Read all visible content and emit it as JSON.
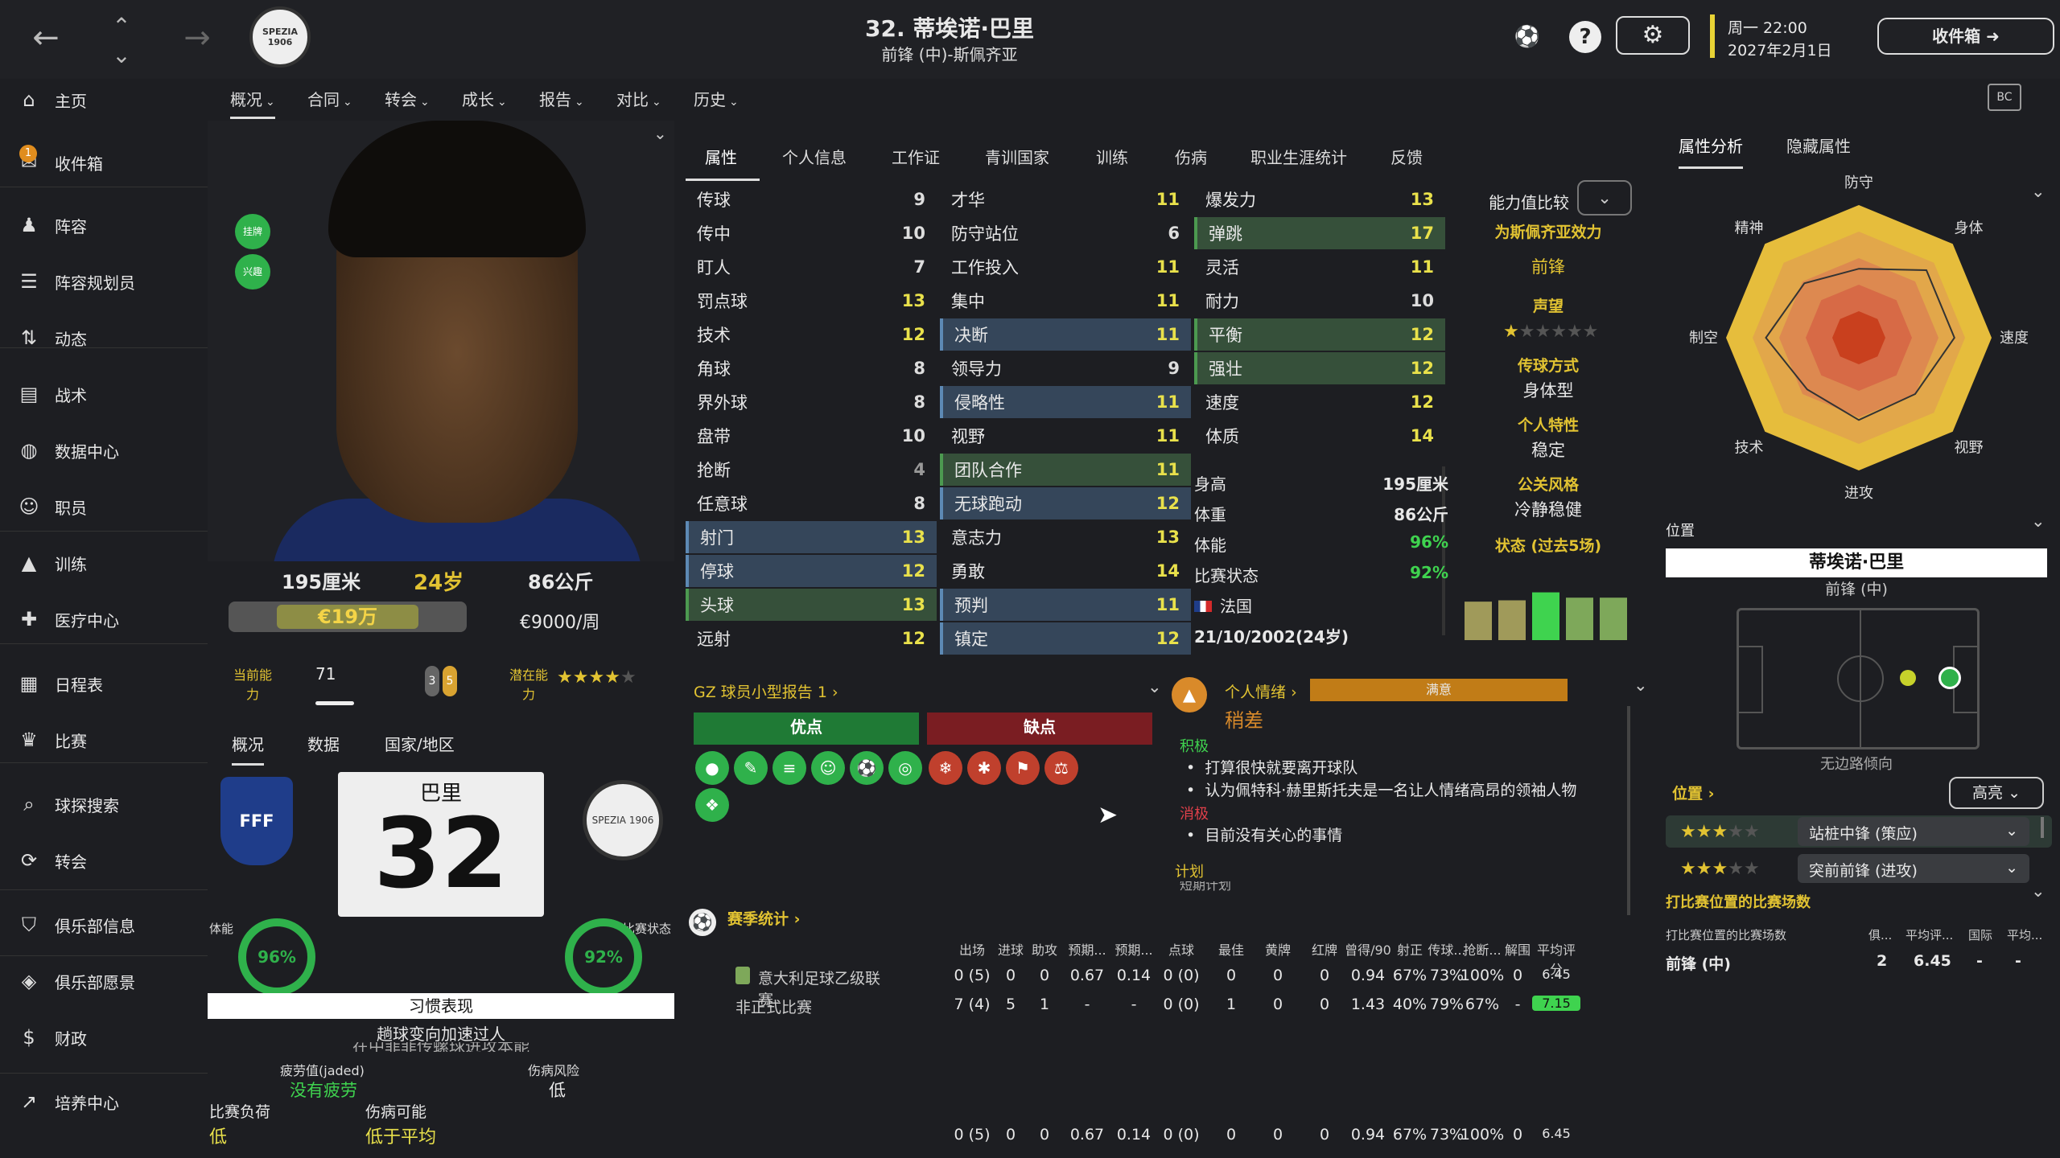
{
  "header": {
    "player_title": "32. 蒂埃诺·巴里",
    "player_subtitle": "前锋 (中)-斯佩齐亚",
    "date_day": "周一 22:00",
    "date_full": "2027年2月1日",
    "inbox_label": "收件箱",
    "club_crest_text": "SPEZIA 1906"
  },
  "sidebar": {
    "items": [
      {
        "label": "主页",
        "icon": "home-icon"
      },
      {
        "label": "收件箱",
        "icon": "inbox-icon",
        "badge": "1"
      },
      {
        "label": "阵容",
        "icon": "squad-icon"
      },
      {
        "label": "阵容规划员",
        "icon": "planner-icon"
      },
      {
        "label": "动态",
        "icon": "dynamics-icon"
      },
      {
        "label": "战术",
        "icon": "tactics-icon"
      },
      {
        "label": "数据中心",
        "icon": "data-hub-icon"
      },
      {
        "label": "职员",
        "icon": "staff-icon"
      },
      {
        "label": "训练",
        "icon": "training-icon"
      },
      {
        "label": "医疗中心",
        "icon": "medical-icon"
      },
      {
        "label": "日程表",
        "icon": "calendar-icon"
      },
      {
        "label": "比赛",
        "icon": "trophy-icon"
      },
      {
        "label": "球探搜索",
        "icon": "search-icon"
      },
      {
        "label": "转会",
        "icon": "transfer-icon"
      },
      {
        "label": "俱乐部信息",
        "icon": "club-info-icon"
      },
      {
        "label": "俱乐部愿景",
        "icon": "club-vision-icon"
      },
      {
        "label": "财政",
        "icon": "finance-icon"
      },
      {
        "label": "培养中心",
        "icon": "development-icon"
      }
    ]
  },
  "subnav": [
    "概况",
    "合同",
    "转会",
    "成长",
    "报告",
    "对比",
    "历史"
  ],
  "profile": {
    "height": "195厘米",
    "age": "24岁",
    "weight": "86公斤",
    "value": "€19万",
    "wage": "€9000/周",
    "current_ability_label": "当前能力",
    "current_ability_value": "71",
    "potential_label": "潜在能力",
    "potential_stars": 4,
    "potential_max": 5,
    "badges": [
      "挂牌",
      "兴趣"
    ],
    "role_min": "3",
    "role_max": "5"
  },
  "lower_tabs": [
    "概况",
    "数据",
    "国家/地区"
  ],
  "kit": {
    "name": "巴里",
    "number": "32"
  },
  "rings": {
    "fitness_label": "体能",
    "fitness": "96%",
    "form_label": "比赛状态",
    "form": "92%"
  },
  "habits": {
    "title": "习惯表现",
    "line1": "趟球变向加速过人",
    "line2": "在中菲菲传螺球进攻本能"
  },
  "condition": {
    "jaded_label": "疲劳值(jaded)",
    "jaded_value": "没有疲劳",
    "injury_label": "伤病风险",
    "injury_value": "低",
    "load_label": "比赛负荷",
    "load_value": "低",
    "injury_prob_label": "伤病可能",
    "injury_prob_value": "低于平均"
  },
  "attr_tabs": [
    "属性",
    "个人信息",
    "工作证",
    "青训国家",
    "训练",
    "伤病",
    "职业生涯统计",
    "反馈"
  ],
  "technical": [
    [
      "传球",
      "9"
    ],
    [
      "传中",
      "10"
    ],
    [
      "盯人",
      "7"
    ],
    [
      "罚点球",
      "13"
    ],
    [
      "技术",
      "12"
    ],
    [
      "角球",
      "8"
    ],
    [
      "界外球",
      "8"
    ],
    [
      "盘带",
      "10"
    ],
    [
      "抢断",
      "4"
    ],
    [
      "任意球",
      "8"
    ],
    [
      "射门",
      "13"
    ],
    [
      "停球",
      "12"
    ],
    [
      "头球",
      "13"
    ],
    [
      "远射",
      "12"
    ]
  ],
  "mental": [
    [
      "才华",
      "11"
    ],
    [
      "防守站位",
      "6"
    ],
    [
      "工作投入",
      "11"
    ],
    [
      "集中",
      "11"
    ],
    [
      "决断",
      "11"
    ],
    [
      "领导力",
      "9"
    ],
    [
      "侵略性",
      "11"
    ],
    [
      "视野",
      "11"
    ],
    [
      "团队合作",
      "11"
    ],
    [
      "无球跑动",
      "12"
    ],
    [
      "意志力",
      "13"
    ],
    [
      "勇敢",
      "14"
    ],
    [
      "预判",
      "11"
    ],
    [
      "镇定",
      "12"
    ]
  ],
  "physical": [
    [
      "爆发力",
      "13"
    ],
    [
      "弹跳",
      "17"
    ],
    [
      "灵活",
      "11"
    ],
    [
      "耐力",
      "10"
    ],
    [
      "平衡",
      "12"
    ],
    [
      "强壮",
      "12"
    ],
    [
      "速度",
      "12"
    ],
    [
      "体质",
      "14"
    ]
  ],
  "stats": [
    [
      "身高",
      "195厘米"
    ],
    [
      "体重",
      "86公斤"
    ],
    [
      "体能",
      "96%"
    ],
    [
      "比赛状态",
      "92%"
    ],
    [
      "国籍",
      "法国"
    ],
    [
      "生日",
      "21/10/2002(24岁)"
    ]
  ],
  "compare": {
    "label": "能力值比较",
    "team_label": "为斯佩齐亚效力",
    "team_value": "前锋",
    "rep_label": "声望",
    "rep_stars": 1,
    "rep_max": 6,
    "style_label": "传球方式",
    "style_value": "身体型",
    "personality_label": "个人特性",
    "personality_value": "稳定",
    "media_label": "公关风格",
    "media_value": "冷静稳健",
    "form_label": "状态 (过去5场)",
    "form_values": [
      5.8,
      6.0,
      7.2,
      6.4,
      6.4
    ]
  },
  "scout": {
    "title": "GZ 球员小型报告 1",
    "strengths_label": "优点",
    "weaknesses_label": "缺点"
  },
  "mood": {
    "title": "个人情绪",
    "status": "满意",
    "level": "稍差",
    "positive_label": "积极",
    "positive_items": [
      "打算很快就要离开球队",
      "认为佩特科·赫里斯托夫是一名让人情绪高昂的领袖人物"
    ],
    "negative_label": "消极",
    "negative_items": [
      "目前没有关心的事情"
    ],
    "plan_label": "计划",
    "plan_sub": "短期计划"
  },
  "season": {
    "title": "赛季统计",
    "headers": [
      "出场",
      "进球",
      "助攻",
      "预期...",
      "预期...",
      "点球",
      "最佳",
      "黄牌",
      "红牌",
      "曾得/90",
      "射正",
      "传球...",
      "抢断...",
      "解围",
      "平均评分"
    ],
    "rows": [
      {
        "name": "意大利足球乙级联赛",
        "cells": [
          "0 (5)",
          "0",
          "0",
          "0.67",
          "0.14",
          "0 (0)",
          "0",
          "0",
          "0",
          "0.94",
          "67%",
          "73%",
          "100%",
          "0",
          "6.45"
        ]
      },
      {
        "name": "非正式比赛",
        "cells": [
          "7 (4)",
          "5",
          "1",
          "-",
          "-",
          "0 (0)",
          "1",
          "0",
          "0",
          "1.43",
          "40%",
          "79%",
          "67%",
          "-",
          "7.15"
        ]
      }
    ],
    "total": [
      "0 (5)",
      "0",
      "0",
      "0.67",
      "0.14",
      "0 (0)",
      "0",
      "0",
      "0",
      "0.94",
      "67%",
      "73%",
      "100%",
      "0",
      "6.45"
    ]
  },
  "right": {
    "tabs": [
      "属性分析",
      "隐藏属性"
    ],
    "radar_labels": [
      "防守",
      "身体",
      "速度",
      "视野",
      "进攻",
      "技术",
      "制空",
      "精神"
    ],
    "position_section": "位置",
    "player_name": "蒂埃诺·巴里",
    "position_main": "前锋 (中)",
    "foot_label": "无边路倾向",
    "positions_label": "位置",
    "highlight_label": "高亮",
    "roles": [
      {
        "stars": 3,
        "name": "站桩中锋 (策应)"
      },
      {
        "stars": 3,
        "name": "突前前锋 (进攻)"
      }
    ],
    "matches_section": "打比赛位置的比赛场数",
    "matches_headers": [
      "打比赛位置的比赛场数",
      "俱...",
      "平均评...",
      "国际",
      "平均..."
    ],
    "matches_row": [
      "前锋 (中)",
      "2",
      "6.45",
      "-",
      "-"
    ]
  },
  "colors": {
    "accent_green": "#3fd34f",
    "accent_yellow": "#e9e14b",
    "gold": "#e2c332",
    "weakness_red": "#7a1d22",
    "strength_green": "#1f7a35"
  }
}
